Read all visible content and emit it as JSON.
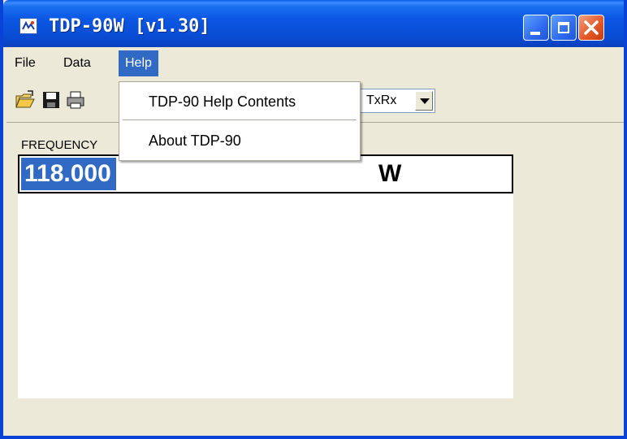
{
  "window": {
    "title": "TDP-90W [v1.30]",
    "app_icon": "tdp-app-icon"
  },
  "caption_buttons": {
    "minimize": "minimize-icon",
    "maximize": "maximize-icon",
    "close": "close-icon"
  },
  "menubar": {
    "items": [
      {
        "label": "File"
      },
      {
        "label": "Data"
      },
      {
        "label": "Help",
        "active": true
      }
    ]
  },
  "help_menu": {
    "items": [
      {
        "label": "TDP-90 Help Contents"
      },
      {
        "label": "About TDP-90"
      }
    ]
  },
  "toolbar": {
    "icons": [
      "open-folder-icon",
      "save-disk-icon",
      "printer-icon"
    ],
    "mode_select": {
      "value": "TxRx"
    }
  },
  "main": {
    "frequency_label": "FREQUENCY",
    "frequency_value": "118.000",
    "frequency_unit": "W"
  },
  "colors": {
    "titlebar": "#0a4fd8",
    "highlight": "#316ac5",
    "face": "#ece9d8",
    "close": "#e45a2a"
  }
}
